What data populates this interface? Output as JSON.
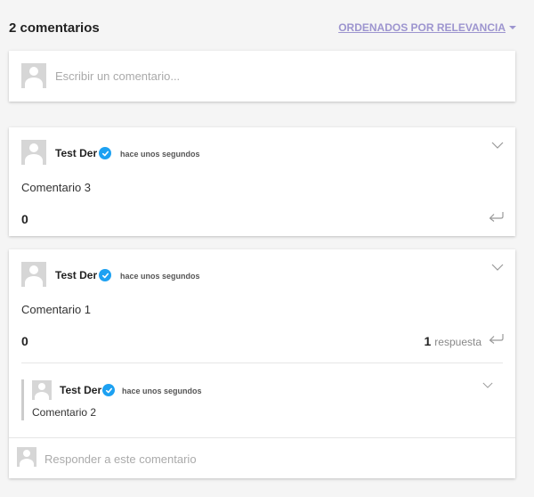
{
  "header": {
    "title": "2 comentarios",
    "sort_label": "ORDENADOS POR RELEVANCIA"
  },
  "composer": {
    "placeholder": "Escribir un comentario..."
  },
  "comments": [
    {
      "author": "Test Der",
      "time": "hace unos segundos",
      "text": "Comentario 3",
      "votes": "0"
    },
    {
      "author": "Test Der",
      "time": "hace unos segundos",
      "text": "Comentario 1",
      "votes": "0",
      "replies_count": "1",
      "replies_label": "respuesta",
      "replies": [
        {
          "author": "Test Der",
          "time": "hace unos segundos",
          "text": "Comentario 2"
        }
      ],
      "reply_placeholder": "Responder a este comentario"
    }
  ],
  "colors": {
    "accent": "#9d95cf",
    "verified": "#1da1f2"
  },
  "icons": {
    "verified": "verified-check-icon",
    "chevron": "chevron-down-icon",
    "reply": "reply-arrow-icon",
    "avatar": "default-avatar-icon"
  }
}
